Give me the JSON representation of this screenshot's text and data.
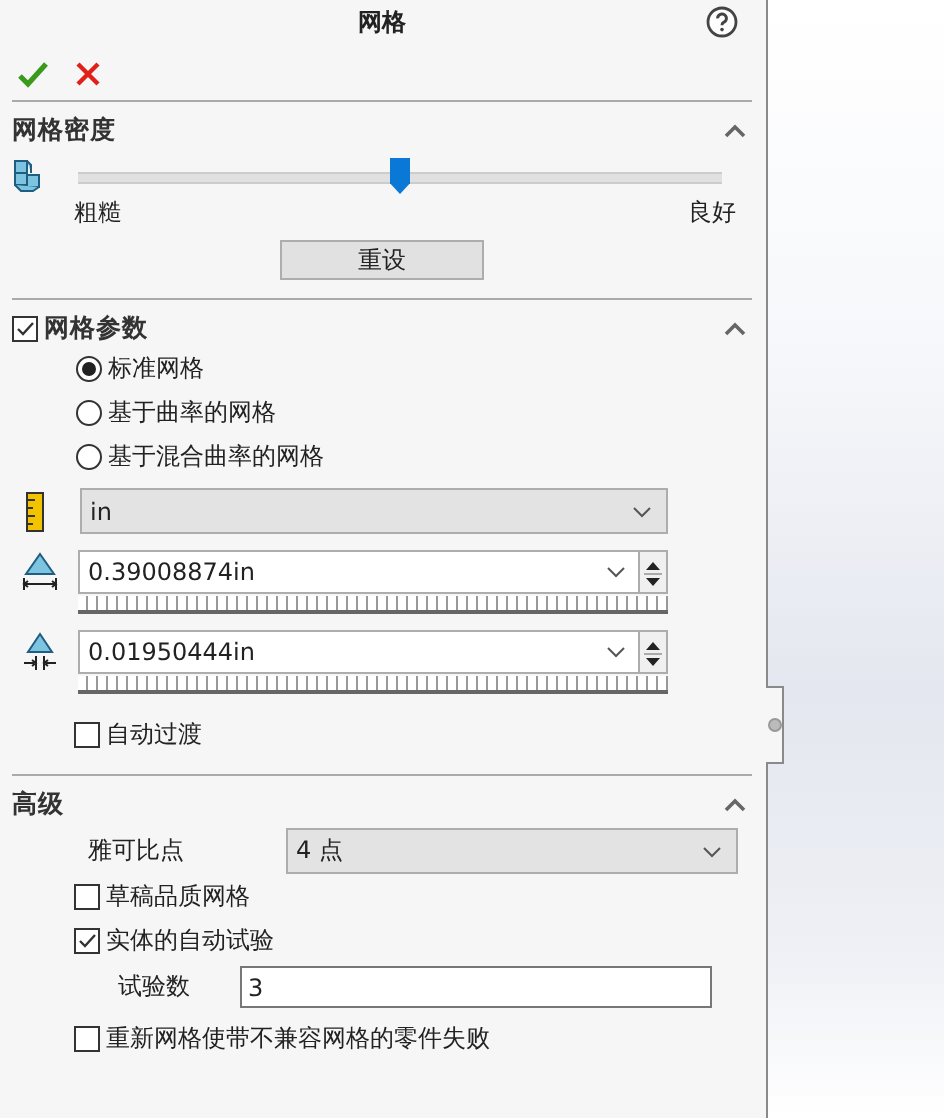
{
  "title": "网格",
  "actions": [
    {
      "kind": "ok"
    },
    {
      "kind": "cancel"
    }
  ],
  "density": {
    "title": "网格密度",
    "expanded": true,
    "level": 0.5,
    "low_label": "粗糙",
    "high_label": "良好",
    "reset_button": "重设"
  },
  "parameters": {
    "title": "网格参数",
    "checked": true,
    "expanded": true,
    "options": [
      {
        "label": "标准网格",
        "selected": true
      },
      {
        "label": "基于曲率的网格",
        "selected": false
      },
      {
        "label": "基于混合曲率的网格",
        "selected": false
      }
    ],
    "unit": "in",
    "sizes": [
      {
        "kind": "global",
        "value": "0.39008874in"
      },
      {
        "kind": "tolerance",
        "value": "0.01950444in"
      }
    ],
    "auto_transition": {
      "label": "自动过渡",
      "checked": false
    }
  },
  "advanced": {
    "title": "高级",
    "expanded": true,
    "jacobian_label": "雅可比点",
    "jacobian_value": "4 点",
    "draft_quality": {
      "label": "草稿品质网格",
      "checked": false
    },
    "auto_trials": {
      "label": "实体的自动试验",
      "checked": true
    },
    "trials_label": "试验数",
    "trials_value": "3",
    "fail_remesh": {
      "label": "重新网格使带不兼容网格的零件失败",
      "checked": false
    }
  }
}
